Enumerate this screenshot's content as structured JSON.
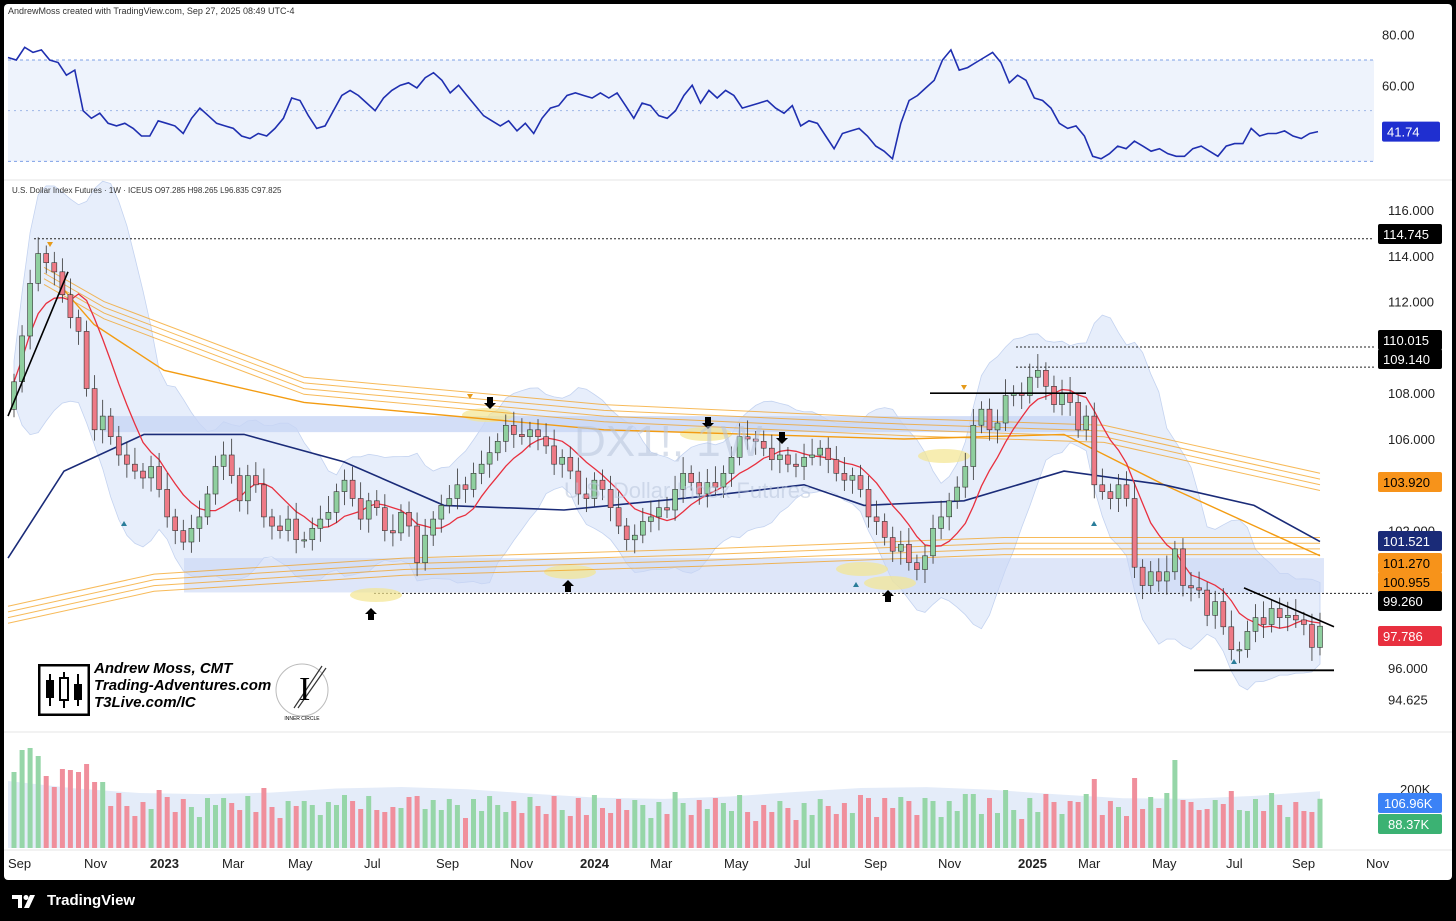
{
  "header": {
    "attribution": "AndrewMoss created with TradingView.com, Sep 27, 2025 08:49 UTC-4",
    "symbol_line": "U.S. Dollar Index Futures · 1W · ICEUS  O97.285  H98.265  L96.835  C97.825"
  },
  "watermark": {
    "symbol": "DX1!, 1W",
    "name": "U.S. Dollar Index Futures"
  },
  "author": {
    "line1": "Andrew Moss, CMT",
    "line2": "Trading-Adventures.com",
    "line3": "T3Live.com/IC",
    "badge_text": "INNER CIRCLE"
  },
  "footer": {
    "brand": "TradingView"
  },
  "colors": {
    "up": "#8fcf9f",
    "down": "#ee7a86",
    "rsi_line": "#1f2fb0",
    "sma_red": "#e8303f",
    "ma_navy": "#1a2b78",
    "ma_orange": "#f39c12",
    "zone": "#c8d6f5",
    "highlight": "#f4e690"
  },
  "chart_data": [
    {
      "type": "line",
      "name": "rsi-panel",
      "yticks": [
        80,
        60
      ],
      "bands": [
        70,
        30
      ],
      "ylim": [
        25,
        85
      ],
      "last_value": "41.74",
      "x": [
        0,
        1,
        2,
        3,
        4,
        5,
        6,
        7,
        8,
        9,
        10,
        11,
        12,
        13,
        14,
        15,
        16,
        17,
        18,
        19,
        20,
        21,
        22,
        23,
        24,
        25,
        26,
        27,
        28,
        29,
        30,
        31,
        32,
        33,
        34,
        35,
        36,
        37,
        38,
        39,
        40,
        41,
        42,
        43,
        44,
        45,
        46,
        47,
        48,
        49,
        50,
        51,
        52,
        53,
        54,
        55,
        56,
        57,
        58,
        59,
        60,
        61,
        62,
        63,
        64,
        65,
        66,
        67,
        68,
        69,
        70,
        71,
        72,
        73,
        74,
        75,
        76,
        77,
        78,
        79,
        80,
        81,
        82,
        83,
        84,
        85,
        86,
        87,
        88,
        89,
        90,
        91,
        92,
        93,
        94,
        95,
        96,
        97,
        98,
        99,
        100,
        101,
        102,
        103,
        104,
        105,
        106,
        107,
        108,
        109,
        110,
        111,
        112,
        113,
        114,
        115,
        116,
        117,
        118,
        119,
        120,
        121,
        122,
        123,
        124,
        125,
        126,
        127,
        128,
        129,
        130,
        131,
        132,
        133,
        134,
        135,
        136,
        137,
        138,
        139,
        140,
        141,
        142,
        143,
        144,
        145,
        146,
        147,
        148,
        149,
        150,
        151,
        152,
        153,
        154,
        155,
        156,
        157
      ],
      "y": [
        71,
        70,
        75,
        73,
        74,
        70,
        69,
        64,
        66,
        50,
        47,
        49,
        45,
        44,
        45,
        43,
        40,
        40,
        46,
        45,
        44,
        41,
        47,
        51,
        48,
        45,
        44,
        43,
        40,
        39,
        41,
        40,
        43,
        47,
        55,
        54,
        48,
        43,
        44,
        50,
        56,
        58,
        56,
        53,
        50,
        55,
        58,
        60,
        61,
        59,
        63,
        65,
        62,
        57,
        60,
        56,
        52,
        48,
        46,
        44,
        46,
        42,
        45,
        41,
        47,
        51,
        52,
        56,
        57,
        56,
        55,
        57,
        55,
        57,
        52,
        47,
        53,
        52,
        48,
        47,
        50,
        56,
        60,
        53,
        58,
        55,
        58,
        56,
        51,
        52,
        53,
        54,
        51,
        49,
        52,
        44,
        46,
        45,
        40,
        35,
        41,
        42,
        43,
        40,
        36,
        34,
        31,
        45,
        54,
        56,
        59,
        62,
        70,
        74,
        66,
        67,
        69,
        71,
        73,
        69,
        61,
        64,
        62,
        55,
        54,
        51,
        45,
        43,
        44,
        40,
        32,
        31,
        33,
        36,
        35,
        38,
        36,
        34,
        35,
        33,
        32,
        32,
        35,
        36,
        34,
        32,
        36,
        37,
        37,
        43,
        40,
        41,
        41,
        42,
        40,
        39,
        41,
        41.74
      ]
    },
    {
      "type": "candlestick",
      "name": "price-panel",
      "symbol": "DX1!",
      "interval": "1W",
      "yticks": [
        116.0,
        114.0,
        112.0,
        108.0,
        106.0,
        102.0,
        96.0,
        94.625
      ],
      "ylim": [
        94.0,
        116.6
      ],
      "price_labels": [
        "114.745",
        "110.015",
        "109.140",
        "103.920",
        "101.521",
        "101.270",
        "100.955",
        "99.260",
        "97.786"
      ],
      "xticks": [
        "Sep",
        "Nov",
        "2023",
        "Mar",
        "May",
        "Jul",
        "Sep",
        "Nov",
        "2024",
        "Mar",
        "May",
        "Jul",
        "Sep",
        "Nov",
        "2025",
        "Mar",
        "May",
        "Jul",
        "Sep",
        "Nov"
      ],
      "weekly_close": [
        108.5,
        110.5,
        112.8,
        114.1,
        113.7,
        113.3,
        112.3,
        111.3,
        110.7,
        108.2,
        106.4,
        107.0,
        106.1,
        105.3,
        104.9,
        104.6,
        104.3,
        104.8,
        103.8,
        102.6,
        102.0,
        101.5,
        102.1,
        102.6,
        103.6,
        104.8,
        105.3,
        104.4,
        103.3,
        104.4,
        104.0,
        102.6,
        102.2,
        102.0,
        102.5,
        101.6,
        101.6,
        102.1,
        102.5,
        102.8,
        103.7,
        104.2,
        103.4,
        102.5,
        103.3,
        103.0,
        102.0,
        101.9,
        102.8,
        102.2,
        100.6,
        101.8,
        102.5,
        103.1,
        103.4,
        104.0,
        103.8,
        104.5,
        104.9,
        105.4,
        105.9,
        106.6,
        106.2,
        106.1,
        106.4,
        106.1,
        105.7,
        104.9,
        105.2,
        104.6,
        103.6,
        103.4,
        104.2,
        103.8,
        103.0,
        102.2,
        101.6,
        101.8,
        102.4,
        102.6,
        103.0,
        102.9,
        103.8,
        104.5,
        104.1,
        103.6,
        104.1,
        103.9,
        104.5,
        105.2,
        106.1,
        106.0,
        105.9,
        105.6,
        105.1,
        105.3,
        104.9,
        104.8,
        105.2,
        105.3,
        105.6,
        105.1,
        104.5,
        104.2,
        104.4,
        103.8,
        102.6,
        102.4,
        101.7,
        101.1,
        101.4,
        100.6,
        100.3,
        100.9,
        102.1,
        102.6,
        103.3,
        103.9,
        104.8,
        106.6,
        107.3,
        106.4,
        106.7,
        107.9,
        108.0,
        107.9,
        108.7,
        109.0,
        108.3,
        107.5,
        108.0,
        107.6,
        106.4,
        107.0,
        104.0,
        103.7,
        103.4,
        104.0,
        103.4,
        100.4,
        99.6,
        100.2,
        99.8,
        100.2,
        101.2,
        99.6,
        99.5,
        99.4,
        98.3,
        98.9,
        97.8,
        96.8,
        96.8,
        97.6,
        98.2,
        97.9,
        98.6,
        98.2,
        98.3,
        98.1,
        97.9,
        96.9,
        97.825
      ],
      "title": ""
    },
    {
      "type": "bar",
      "name": "volume-panel",
      "ytick": "200K",
      "labels": [
        "106.96K",
        "88.37K"
      ],
      "title": ""
    }
  ]
}
